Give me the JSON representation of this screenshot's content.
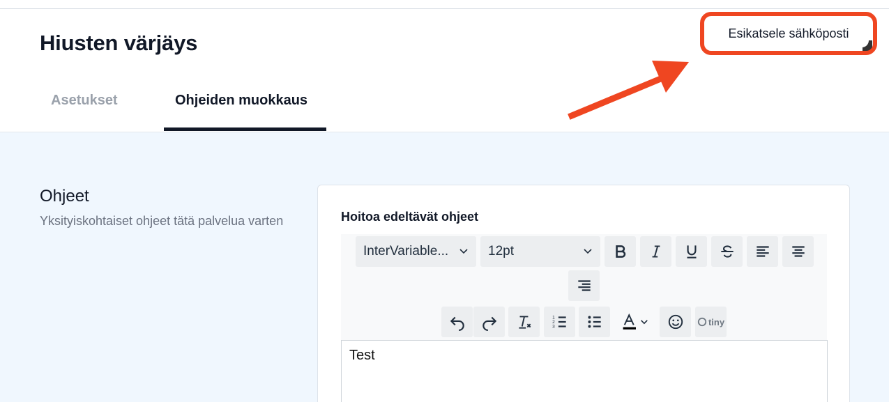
{
  "header": {
    "title": "Hiusten värjäys",
    "preview_button": "Esikatsele sähköposti"
  },
  "tabs": [
    {
      "label": "Asetukset",
      "active": false
    },
    {
      "label": "Ohjeiden muokkaus",
      "active": true
    }
  ],
  "section": {
    "title": "Ohjeet",
    "description": "Yksityiskohtaiset ohjeet tätä palvelua varten"
  },
  "editor_field": {
    "label": "Hoitoa edeltävät ohjeet",
    "font_family": "InterVariable...",
    "font_size": "12pt",
    "content": "Test",
    "branding": "tiny",
    "toolbar_icons": [
      "bold-icon",
      "italic-icon",
      "underline-icon",
      "strikethrough-icon",
      "align-left-icon",
      "align-center-icon",
      "align-right-icon",
      "undo-icon",
      "redo-icon",
      "clear-formatting-icon",
      "numbered-list-icon",
      "bulleted-list-icon",
      "text-color-icon",
      "emoji-icon"
    ]
  },
  "colors": {
    "highlight": "#ef4621",
    "content_bg": "#f0f7fe",
    "tab_active": "#111827",
    "tab_inactive": "#9aa1ab"
  }
}
